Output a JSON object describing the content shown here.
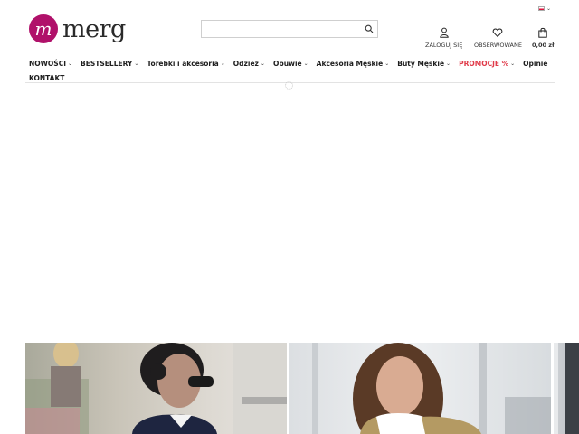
{
  "header": {
    "logo_text": "merg",
    "logo_letter": "m",
    "search": {
      "placeholder": "",
      "value": ""
    },
    "language_flag": "pl-flag-icon",
    "login_label": "ZALOGUJ SIĘ",
    "observed_label": "OBSERWOWANE",
    "cart_total": "0,00 zł"
  },
  "nav": {
    "items": [
      {
        "label": "NOWOŚCI",
        "has_dropdown": true
      },
      {
        "label": "BESTSELLERY",
        "has_dropdown": true
      },
      {
        "label": "Torebki i akcesoria",
        "has_dropdown": true
      },
      {
        "label": "Odzież",
        "has_dropdown": true
      },
      {
        "label": "Obuwie",
        "has_dropdown": true
      },
      {
        "label": "Akcesoria Męskie",
        "has_dropdown": true
      },
      {
        "label": "Buty Męskie",
        "has_dropdown": true
      },
      {
        "label": "PROMOCJE %",
        "has_dropdown": true
      },
      {
        "label": "Opinie",
        "has_dropdown": false
      },
      {
        "label": "KONTAKT",
        "has_dropdown": false
      }
    ]
  },
  "icons": {
    "search": "search-icon",
    "login": "user-icon",
    "observed": "heart-icon",
    "cart": "shopping-bag-icon",
    "loading": "loading-spinner-icon"
  },
  "colors": {
    "brand": "#b0116a",
    "promo": "#e03b4a",
    "text": "#1e1e1e"
  }
}
